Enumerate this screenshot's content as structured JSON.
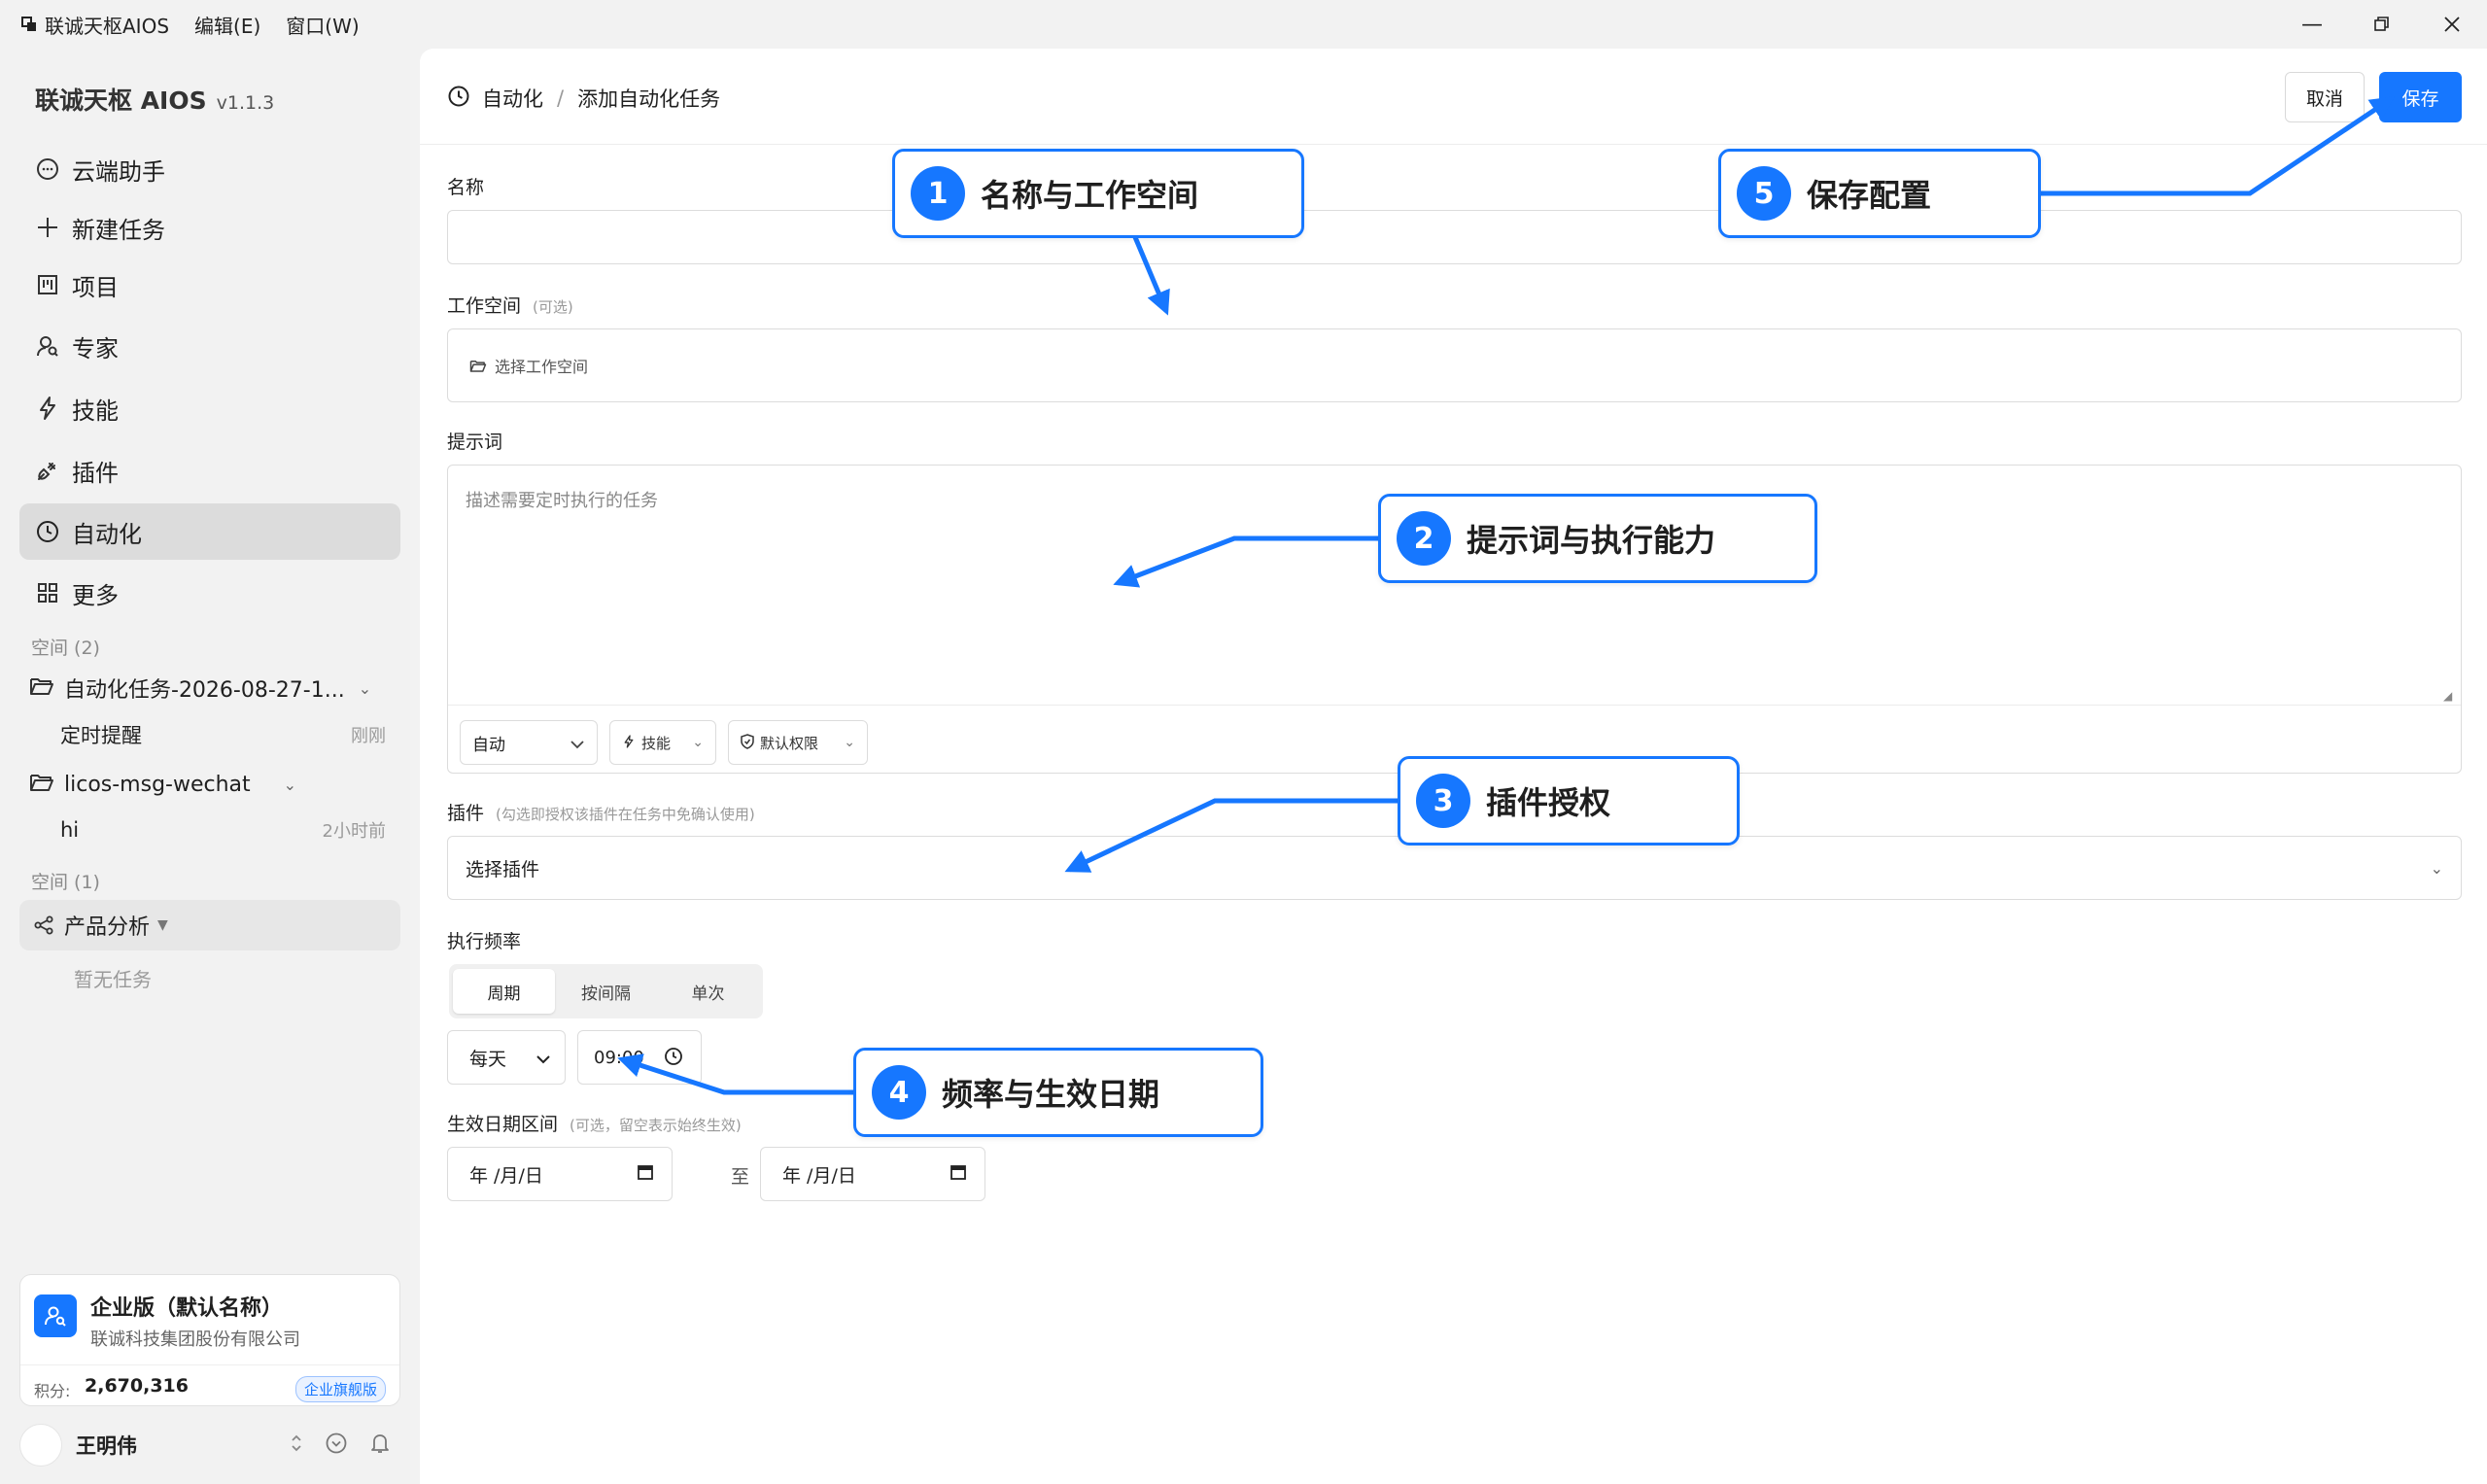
{
  "titlebar": {
    "app_name": "联诚天枢AIOS",
    "menu": [
      "编辑(E)",
      "窗口(W)"
    ]
  },
  "sidebar": {
    "brand": "联诚天枢 AIOS",
    "version": "v1.1.3",
    "nav": [
      {
        "label": "云端助手",
        "icon": "chat-bubble-icon"
      },
      {
        "label": "新建任务",
        "icon": "plus-icon"
      },
      {
        "label": "项目",
        "icon": "kanban-icon"
      },
      {
        "label": "专家",
        "icon": "person-search-icon"
      },
      {
        "label": "技能",
        "icon": "lightning-icon"
      },
      {
        "label": "插件",
        "icon": "plug-icon"
      },
      {
        "label": "自动化",
        "icon": "clock-icon",
        "active": true
      },
      {
        "label": "更多",
        "icon": "grid-icon"
      }
    ],
    "section1_label": "空间 (2)",
    "spaces": [
      {
        "label": "自动化任务-2026-08-27-1...",
        "tasks": [
          {
            "label": "定时提醒",
            "time": "刚刚"
          }
        ]
      },
      {
        "label": "licos-msg-wechat",
        "tasks": [
          {
            "label": "hi",
            "time": "2小时前"
          }
        ]
      }
    ],
    "section2_label": "空间 (1)",
    "group": {
      "label": "产品分析",
      "empty": "暂无任务"
    },
    "enterprise": {
      "title": "企业版（默认名称）",
      "company": "联诚科技集团股份有限公司",
      "points_label": "积分:",
      "points_value": "2,670,316",
      "badge": "企业旗舰版"
    },
    "user": {
      "name": "王明伟"
    }
  },
  "main": {
    "breadcrumb": {
      "root": "自动化",
      "separator": "/",
      "current": "添加自动化任务"
    },
    "cancel_label": "取消",
    "save_label": "保存",
    "name_label": "名称",
    "name_value": "",
    "workspace_label": "工作空间",
    "workspace_hint": "(可选)",
    "workspace_placeholder": "选择工作空间",
    "prompt_label": "提示词",
    "prompt_placeholder": "描述需要定时执行的任务",
    "mode_select": "自动",
    "skills_chip": "技能",
    "perm_chip": "默认权限",
    "plugin_label": "插件",
    "plugin_hint": "(勾选即授权该插件在任务中免确认使用)",
    "plugin_placeholder": "选择插件",
    "freq_label": "执行频率",
    "freq_options": [
      "周期",
      "按间隔",
      "单次"
    ],
    "freq_active": "周期",
    "period_select": "每天",
    "time_value": "09:00",
    "date_label": "生效日期区间",
    "date_hint": "(可选，留空表示始终生效)",
    "date_start": "年 /月/日",
    "date_to": "至",
    "date_end": "年 /月/日"
  },
  "callouts": [
    {
      "num": "1",
      "text": "名称与工作空间"
    },
    {
      "num": "2",
      "text": "提示词与执行能力"
    },
    {
      "num": "3",
      "text": "插件授权"
    },
    {
      "num": "4",
      "text": "频率与生效日期"
    },
    {
      "num": "5",
      "text": "保存配置"
    }
  ],
  "colors": {
    "accent": "#1677ff",
    "active_nav": "#dcdcdc",
    "sidebar_bg": "#f2f2f2"
  }
}
